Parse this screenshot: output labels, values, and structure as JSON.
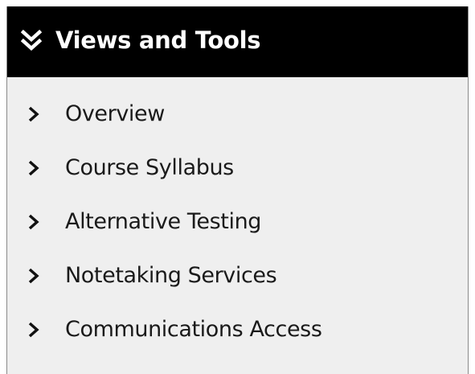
{
  "panel": {
    "title": "Views and Tools",
    "header_icon": "double-chevron-down-icon",
    "item_icon": "chevron-right-icon",
    "colors": {
      "header_bg": "#000000",
      "header_text": "#ffffff",
      "panel_bg": "#efefef",
      "item_text": "#1a1a1a"
    },
    "items": [
      {
        "label": "Overview"
      },
      {
        "label": "Course Syllabus"
      },
      {
        "label": "Alternative Testing"
      },
      {
        "label": "Notetaking Services"
      },
      {
        "label": "Communications Access"
      }
    ]
  }
}
